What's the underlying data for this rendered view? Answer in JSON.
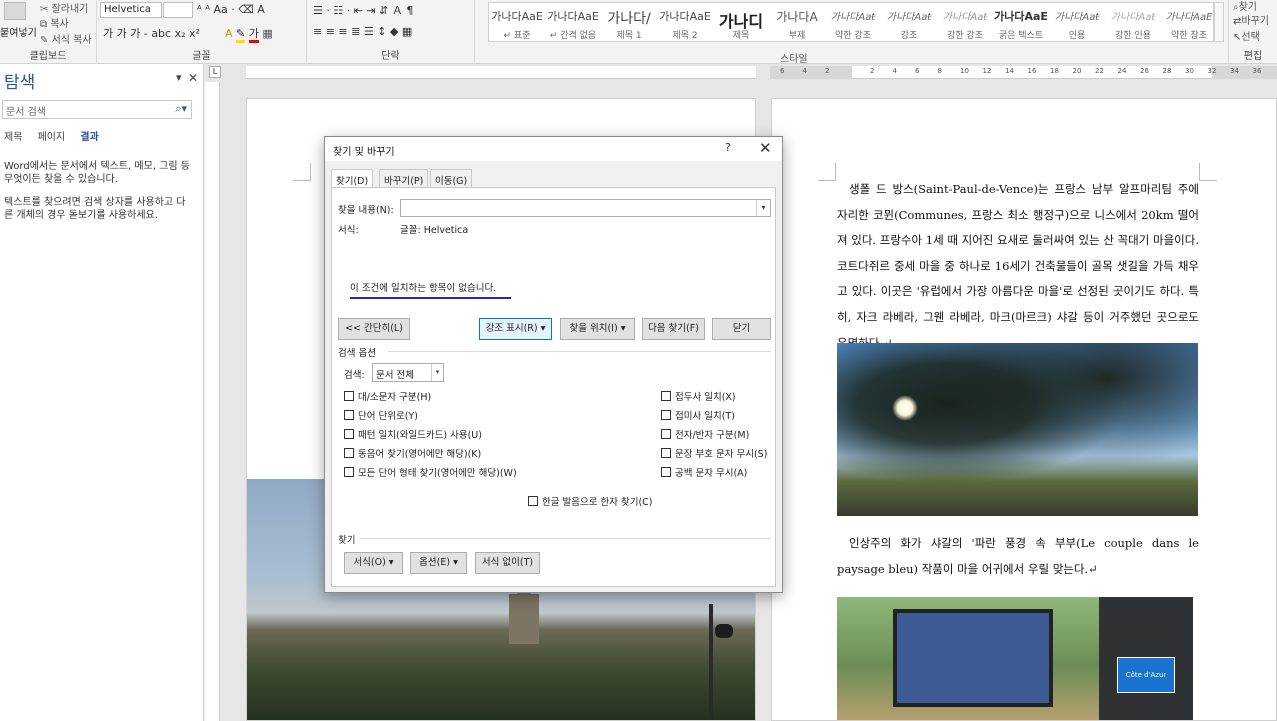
{
  "ribbon": {
    "clipboard": {
      "paste": "붙여넣기",
      "cut": "잘라내기",
      "copy": "복사",
      "format_painter": "서식 복사",
      "label": "클립보드"
    },
    "font": {
      "name": "Helvetica",
      "size": "",
      "label": "글꼴",
      "row2": "가 가 가 - abc x₂ x²"
    },
    "paragraph": {
      "label": "단락"
    },
    "styles": {
      "label": "스타일",
      "items": [
        {
          "sample": "가나다AaE",
          "name": "↵ 표준"
        },
        {
          "sample": "가나다AaE",
          "name": "↵ 간격 없음"
        },
        {
          "sample": "가나다/",
          "name": "제목 1"
        },
        {
          "sample": "가나다AaE",
          "name": "제목 2"
        },
        {
          "sample": "가나디",
          "name": "제목"
        },
        {
          "sample": "가나다A",
          "name": "부제"
        },
        {
          "sample": "가나다Aaŧ",
          "name": "약한 강조"
        },
        {
          "sample": "가나다Aaŧ",
          "name": "강조"
        },
        {
          "sample": "가나다Aaŧ",
          "name": "강한 강조"
        },
        {
          "sample": "가나다AaE",
          "name": "굵은 텍스트"
        },
        {
          "sample": "가나다Aaŧ",
          "name": "인용"
        },
        {
          "sample": "가나다Aaŧ",
          "name": "강한 인용"
        },
        {
          "sample": "가나다AaE",
          "name": "약한 참조"
        }
      ]
    },
    "editing": {
      "find": "찾기",
      "replace": "바꾸기",
      "select": "선택",
      "label": "편집"
    }
  },
  "nav": {
    "title": "탐색",
    "search_placeholder": "문서 검색",
    "tabs": [
      "제목",
      "페이지",
      "결과"
    ],
    "message1": "Word에서는 문서에서 텍스트, 메모, 그림 등 무엇이든 찾을 수 있습니다.",
    "message2": "텍스트를 찾으려면 검색 상자를 사용하고 다른 개체의 경우 돋보기를 사용하세요."
  },
  "ruler_numbers": [
    "6",
    "4",
    "2",
    "",
    "2",
    "4",
    "6",
    "8",
    "10",
    "12",
    "14",
    "16",
    "18",
    "20",
    "22",
    "24",
    "26",
    "28",
    "30",
    "32",
    "34",
    "36"
  ],
  "document": {
    "para1": "생폴 드 방스(Saint-Paul-de-Vence)는 프랑스 남부 알프마리팀 주에 자리한 코뮌(Communes, 프랑스 최소 행정구)으로 니스에서 20km 떨어져 있다. 프랑수아 1세 때 지어진 요새로 둘러싸여 있는 산 꼭대기 마을이다. 코트다쥐르 중세 마을 중 하나로 16세기 건축물들이 골목 샛길을 가득 채우고 있다. 이곳은 '유럽에서 가장 아름다운 마을'로 선정된 곳이기도 하다. 특히, 자크 라베라, 그웬 라베라, 마크(마르크) 샤갈 등이 거주했던 곳으로도 유명하다.↵",
    "para2": "인상주의 화가 샤갈의 '파란 풍경 속 부부(Le couple dans le paysage bleu) 작품이 마을 어귀에서 우릴 맞는다.↵",
    "sign_text": "Côte d'Azur"
  },
  "dialog": {
    "title": "찾기 및 바꾸기",
    "help": "?",
    "close": "✕",
    "tabs": [
      "찾기(D)",
      "바꾸기(P)",
      "이동(G)"
    ],
    "find_label": "찾을 내용(N):",
    "find_value": "",
    "format_label": "서식:",
    "format_value": "글꼴: Helvetica",
    "no_match": "이 조건에 일치하는 항목이 없습니다.",
    "btn_less": "<< 간단히(L)",
    "btn_highlight": "강조 표시(R) ▾",
    "btn_find_in": "찾을 위치(I) ▾",
    "btn_find_next": "다음 찾기(F)",
    "btn_close": "닫기",
    "search_options_label": "검색 옵션",
    "search_label": "검색:",
    "search_value": "문서 전체",
    "options_left": [
      "대/소문자 구분(H)",
      "단어 단위로(Y)",
      "패턴 일치(와일드카드) 사용(U)",
      "동음어 찾기(영어에만 해당)(K)",
      "모든 단어 형태 찾기(영어에만 해당)(W)"
    ],
    "options_right": [
      "접두사 일치(X)",
      "접미사 일치(T)",
      "전자/반자 구분(M)",
      "문장 부호 문자 무시(S)",
      "공백 문자 무시(A)"
    ],
    "hanja_option": "한글 발음으로 한자 찾기(C)",
    "find_section_label": "찾기",
    "btn_format": "서식(O) ▾",
    "btn_special": "옵션(E) ▾",
    "btn_no_format": "서식 없이(T)"
  }
}
